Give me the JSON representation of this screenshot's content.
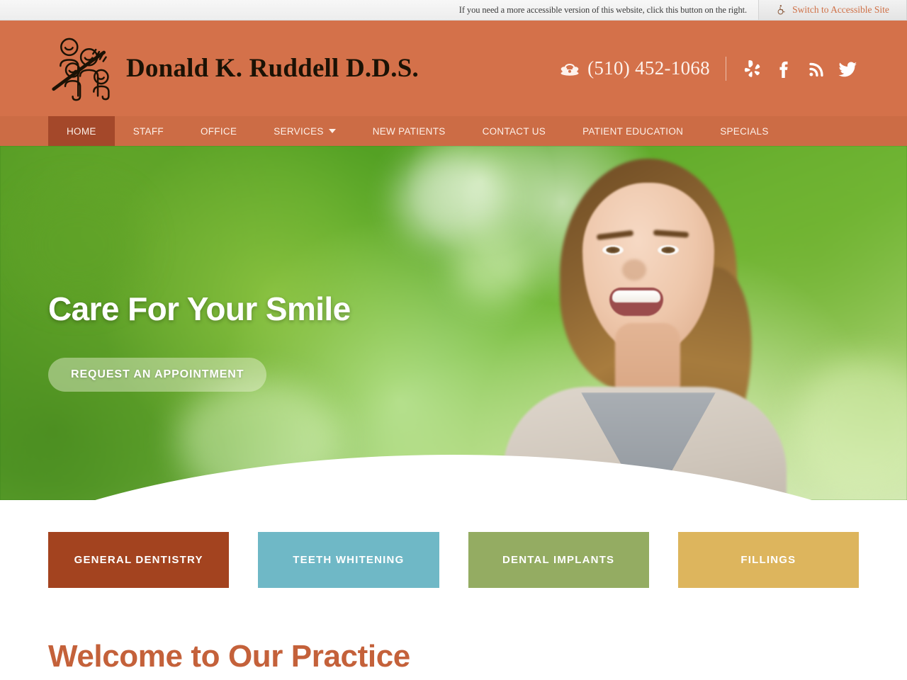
{
  "accessibility_bar": {
    "message": "If you need a more accessible version of this website, click this button on the right.",
    "button_label": "Switch to Accessible Site",
    "icon": "wheelchair-icon",
    "button_text_color": "#cf7046"
  },
  "header": {
    "logo_icon": "family-dental-logo-icon",
    "practice_name": "Donald K. Ruddell D.D.S.",
    "phone_icon": "telephone-icon",
    "phone": "(510) 452-1068",
    "background_color": "#d4714a",
    "socials": [
      {
        "name": "yelp-icon",
        "label": "Yelp"
      },
      {
        "name": "facebook-icon",
        "label": "Facebook"
      },
      {
        "name": "rss-icon",
        "label": "RSS"
      },
      {
        "name": "twitter-icon",
        "label": "Twitter"
      }
    ]
  },
  "nav": {
    "background_color": "#cc6c45",
    "active_color": "#a4482a",
    "items": [
      {
        "label": "HOME",
        "active": true,
        "has_dropdown": false
      },
      {
        "label": "STAFF",
        "active": false,
        "has_dropdown": false
      },
      {
        "label": "OFFICE",
        "active": false,
        "has_dropdown": false
      },
      {
        "label": "SERVICES",
        "active": false,
        "has_dropdown": true
      },
      {
        "label": "NEW PATIENTS",
        "active": false,
        "has_dropdown": false
      },
      {
        "label": "CONTACT US",
        "active": false,
        "has_dropdown": false
      },
      {
        "label": "PATIENT EDUCATION",
        "active": false,
        "has_dropdown": false
      },
      {
        "label": "SPECIALS",
        "active": false,
        "has_dropdown": false
      }
    ]
  },
  "hero": {
    "title": "Care For Your Smile",
    "cta_label": "REQUEST AN APPOINTMENT",
    "image_description": "Smiling young woman with brown hair in grey top against blurred green foliage"
  },
  "service_tiles": [
    {
      "label": "GENERAL DENTISTRY",
      "color": "#a3431f"
    },
    {
      "label": "TEETH WHITENING",
      "color": "#6fb8c6"
    },
    {
      "label": "DENTAL IMPLANTS",
      "color": "#94ac62"
    },
    {
      "label": "FILLINGS",
      "color": "#ddb55d"
    }
  ],
  "welcome": {
    "title": "Welcome to Our Practice",
    "title_color": "#c4613a"
  }
}
